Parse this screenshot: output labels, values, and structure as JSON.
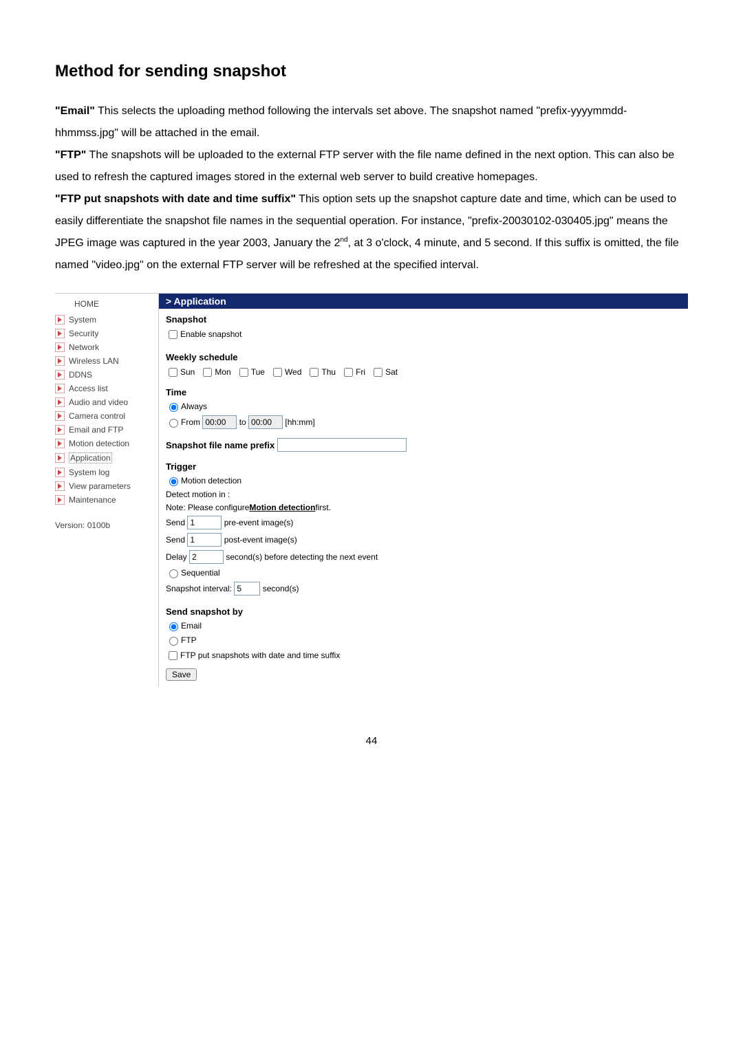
{
  "doc": {
    "heading": "Method for sending snapshot",
    "para_email_label": "\"Email\"",
    "para_email_text": " This selects the uploading method following the intervals set above. The snapshot named \"prefix-yyyymmdd-hhmmss.jpg\" will be attached in the email.",
    "para_ftp_label": "\"FTP\"",
    "para_ftp_text": " The snapshots will be uploaded to the external FTP server with the file name defined in the next option. This can also be used to refresh the captured images stored in the external web server to build creative homepages.",
    "para_suffix_label": "\"FTP put snapshots with date and time suffix\"",
    "para_suffix_text_a": " This option sets up the snapshot capture date and time, which can be used to easily differentiate the snapshot file names in the sequential operation. For instance, \"prefix-20030102-030405.jpg\" means the JPEG image was captured in the year 2003, January the 2",
    "para_suffix_sup": "nd",
    "para_suffix_text_b": ", at 3 o'clock, 4 minute, and 5 second. If this suffix is omitted, the file named \"video.jpg\" on the external FTP server will be refreshed at the specified interval.",
    "page_number": "44"
  },
  "nav": {
    "home": "HOME",
    "items": [
      "System",
      "Security",
      "Network",
      "Wireless LAN",
      "DDNS",
      "Access list",
      "Audio and video",
      "Camera control",
      "Email and FTP",
      "Motion detection",
      "Application",
      "System log",
      "View parameters",
      "Maintenance"
    ],
    "version": "Version: 0100b"
  },
  "app": {
    "header": "> Application",
    "snapshot_label": "Snapshot",
    "enable_snapshot": "Enable snapshot",
    "weekly_label": "Weekly schedule",
    "days": [
      "Sun",
      "Mon",
      "Tue",
      "Wed",
      "Thu",
      "Fri",
      "Sat"
    ],
    "time_label": "Time",
    "always": "Always",
    "from": "From",
    "to": "to",
    "from_val": "00:00",
    "to_val": "00:00",
    "hhmm": "[hh:mm]",
    "prefix_label": "Snapshot file name prefix",
    "prefix_val": "",
    "trigger_label": "Trigger",
    "motion_detection": "Motion detection",
    "detect_in": "Detect motion in :",
    "note_a": "Note: Please configure ",
    "note_link": "Motion detection",
    "note_b": " first.",
    "send_a": "Send",
    "pre_val": "1",
    "pre_text": "pre-event image(s)",
    "post_val": "1",
    "post_text": "post-event image(s)",
    "delay": "Delay",
    "delay_val": "2",
    "delay_text": "second(s) before detecting the next event",
    "sequential": "Sequential",
    "interval_label": "Snapshot interval:",
    "interval_val": "5",
    "interval_unit": "second(s)",
    "sendby_label": "Send snapshot by",
    "email": "Email",
    "ftp": "FTP",
    "ftp_suffix": "FTP put snapshots with date and time suffix",
    "save": "Save"
  }
}
